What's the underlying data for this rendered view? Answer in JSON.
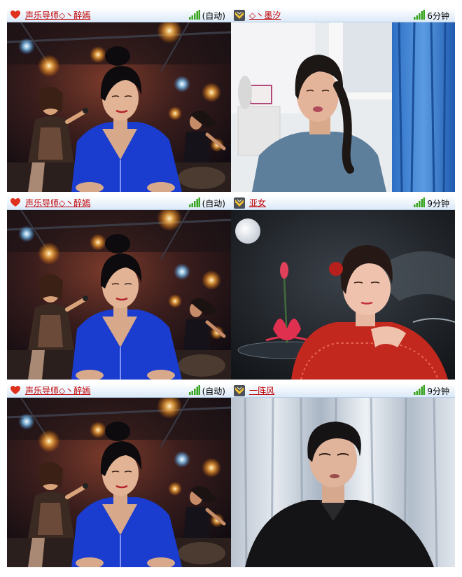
{
  "sessions": [
    {
      "left": {
        "name": "声乐导师◇丶醉嫣",
        "status": "(自动)",
        "icon": "heart-icon"
      },
      "right": {
        "name": "◇丶墨汐",
        "status": "6分钟",
        "icon": "rank-badge-icon"
      }
    },
    {
      "left": {
        "name": "声乐导师◇丶醉嫣",
        "status": "(自动)",
        "icon": "heart-icon"
      },
      "right": {
        "name": "亚女",
        "status": "9分钟",
        "icon": "rank-badge-icon"
      }
    },
    {
      "left": {
        "name": "声乐导师◇丶醉嫣",
        "status": "(自动)",
        "icon": "heart-icon"
      },
      "right": {
        "name": "一阵风",
        "status": "9分钟",
        "icon": "rank-badge-icon"
      }
    }
  ],
  "colors": {
    "header_top": "#ffffff",
    "header_bottom": "#dbe9f8",
    "name_link": "#c00000",
    "signal": "#3aa520",
    "heart": "#e0301e"
  }
}
